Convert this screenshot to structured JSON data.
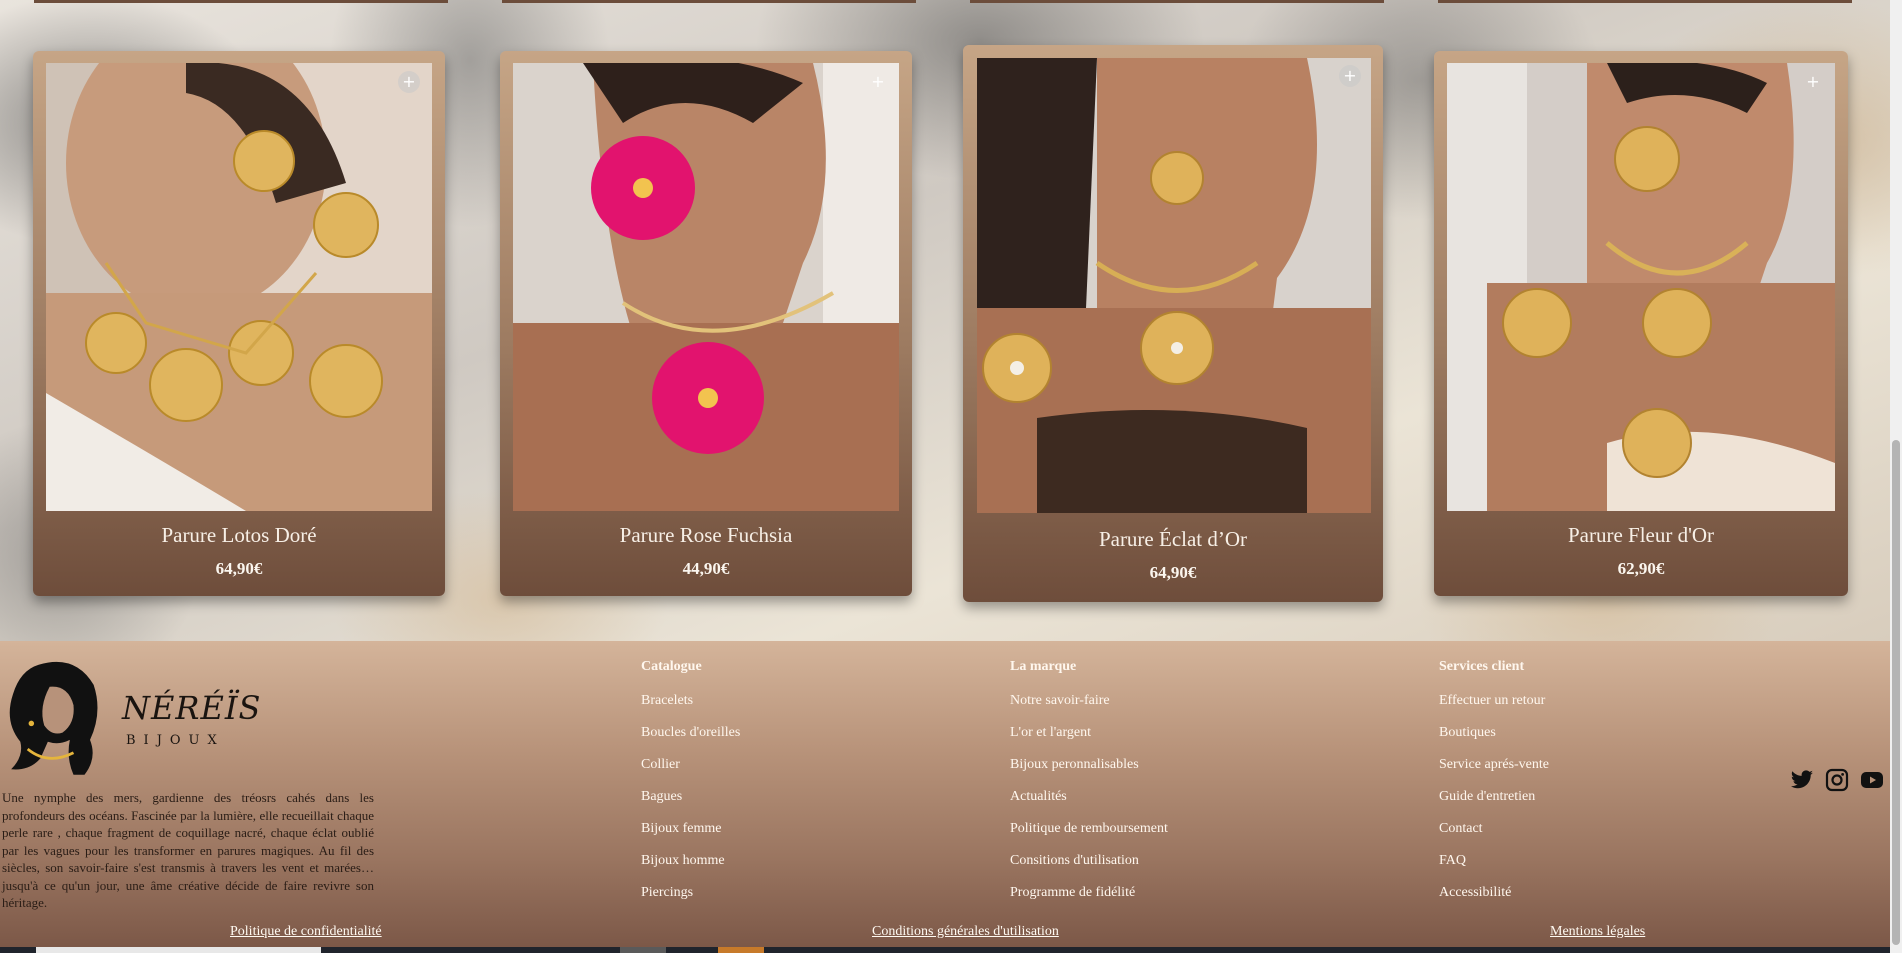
{
  "products": [
    {
      "title": "Parure Lotos Doré",
      "price": "64,90€",
      "theme": "gold-flowers-white"
    },
    {
      "title": "Parure Rose Fuchsia",
      "price": "44,90€",
      "theme": "fuchsia-flower"
    },
    {
      "title": "Parure Éclat d’Or",
      "price": "64,90€",
      "theme": "gold-flower-brown"
    },
    {
      "title": "Parure Fleur d'Or",
      "price": "62,90€",
      "theme": "gold-flower-cream"
    }
  ],
  "add_icon": "+",
  "footer": {
    "brand": {
      "name": "NÉRÉÏS",
      "sub": "BIJOUX"
    },
    "about": "Une nymphe des mers, gardienne des tréosrs cahés dans les profondeurs des océans. Fascinée par la lumière, elle recueillait chaque perle rare , chaque fragment de coquillage nacré, chaque éclat oublié par les vagues pour les transformer en parures magiques. Au fil des siècles, son savoir-faire s'est transmis à travers les vent et marées… jusqu'à ce qu'un jour, une âme créative décide de faire revivre son héritage.",
    "columns": [
      {
        "title": "Catalogue",
        "links": [
          "Bracelets",
          "Boucles d'oreilles",
          "Collier",
          "Bagues",
          "Bijoux femme",
          "Bijoux homme",
          "Piercings"
        ]
      },
      {
        "title": "La marque",
        "links": [
          "Notre savoir-faire",
          "L'or et l'argent",
          "Bijoux peronnalisables",
          "Actualités",
          "Politique de remboursement",
          "Consitions d'utilisation",
          "Programme de fidélité"
        ]
      },
      {
        "title": "Services client",
        "links": [
          "Effectuer un retour",
          "Boutiques",
          "Service aprés-vente",
          "Guide d'entretien",
          "Contact",
          "FAQ",
          "Accessibilité"
        ]
      }
    ],
    "social": [
      "twitter-icon",
      "instagram-icon",
      "youtube-icon"
    ],
    "legal": [
      "Politique de confidentialité",
      "Conditions générales d'utilisation",
      "Mentions légales"
    ]
  }
}
